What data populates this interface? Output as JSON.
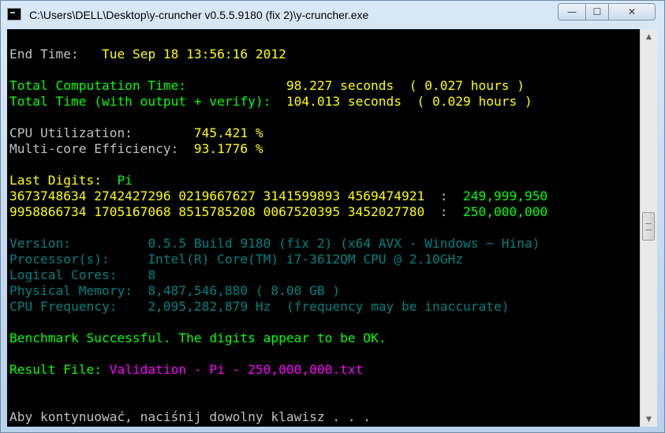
{
  "window": {
    "title": "C:\\Users\\DELL\\Desktop\\y-cruncher v0.5.5.9180 (fix 2)\\y-cruncher.exe",
    "minimize_glyph": "—",
    "maximize_glyph": "☐",
    "close_glyph": "✕",
    "icon": "console-app-icon"
  },
  "console": {
    "end_time": {
      "label": "End Time:",
      "value": "Tue Sep 18 13:56:16 2012"
    },
    "total_computation_time": {
      "label": "Total Computation Time:",
      "value": "98.227 seconds  ( 0.027 hours )"
    },
    "total_time": {
      "label": "Total Time (with output + verify):",
      "value": "104.013 seconds  ( 0.029 hours )"
    },
    "cpu_utilization": {
      "label": "CPU Utilization:",
      "value": "745.421 %"
    },
    "multicore_efficiency": {
      "label": "Multi-core Efficiency:",
      "value": "93.1776 %"
    },
    "last_digits": {
      "label": "Last Digits:",
      "value": "Pi"
    },
    "digit_lines": [
      {
        "digits": "3673748634 2742427296 0219667627 3141599893 4569474921",
        "sep": ":",
        "position": "249,999,950"
      },
      {
        "digits": "9958866734 1705167068 8515785208 0067520395 3452027780",
        "sep": ":",
        "position": "250,000,000"
      }
    ],
    "version": {
      "label": "Version:",
      "value": "0.5.5 Build 9180 (fix 2) (x64 AVX - Windows ~ Hina)"
    },
    "processor": {
      "label": "Processor(s):",
      "value": "Intel(R) Core(TM) i7-3612QM CPU @ 2.10GHz"
    },
    "logical_cores": {
      "label": "Logical Cores:",
      "value": "8"
    },
    "physical_memory": {
      "label": "Physical Memory:",
      "value": "8,487,546,880 ( 8.00 GB )"
    },
    "cpu_frequency": {
      "label": "CPU Frequency:",
      "value": "2,095,282,879 Hz  (frequency may be inaccurate)"
    },
    "benchmark_message": "Benchmark Successful. The digits appear to be OK.",
    "result_file": {
      "label": "Result File:",
      "value": "Validation - Pi - 250,000,000.txt"
    },
    "prompt": "Aby kontynuować, naciśnij dowolny klawisz . . ."
  },
  "scrollbar": {
    "up_glyph": "▲",
    "down_glyph": "▼"
  }
}
